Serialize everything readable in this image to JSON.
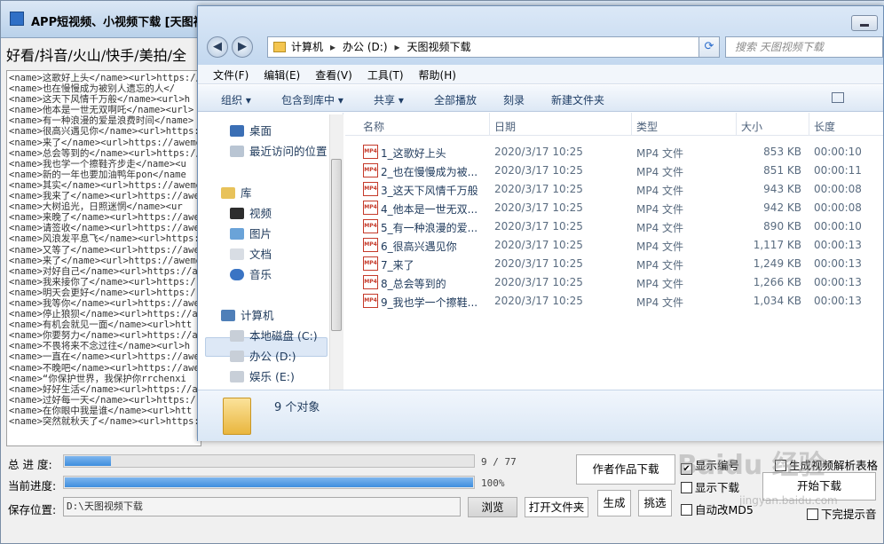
{
  "app": {
    "title": "APP短视频、小视频下载 [天图视频",
    "platforms": "好看/抖音/火山/快手/美拍/全",
    "log_lines": [
      "<name>这歌好上头</name><url>https://",
      "<name>也在慢慢成为被别人遗忘的人</",
      "<name>这天下风情千万般</name><url>h",
      "<name>他本是一世无双啊吒</name><url>",
      "<name>有一种浪漫的爱是浪费时间</name>",
      "<name>很高兴遇见你</name><url>https:",
      "<name>来了</name><url>https://aweme",
      "<name>总会等到的</name><url>https://",
      "<name>我也学一个擦鞋齐步走</name><u",
      "<name>新的一年也要加油鸭年pon</name",
      "<name>其实</name><url>https://aweme",
      "<name>我来了</name><url>https://awe",
      "<name>大树追光，日照迷惘</name><ur",
      "<name>来晚了</name><url>https://awe",
      "<name>请签收</name><url>https://awe",
      "<name>风浪发平息飞</name><url>https:",
      "<name>又等了</name><url>https://awe",
      "<name>来了</name><url>https://aweme",
      "<name>对好自己</name><url>https://a",
      "<name>我来接你了</name><url>https:/",
      "<name>明天会更好</name><url>https:/",
      "<name>我等你</name><url>https://awe",
      "<name>停止狼狈</name><url>https://a",
      "<name>有机会就见一面</name><url>htt",
      "<name>你要努力</name><url>https://a",
      "<name>不畏将来不念过往</name><url>h",
      "<name>一直在</name><url>https://awe",
      "<name>不晚吧</name><url>https://awe",
      "<name>“你保护世界，我保护你rrchenxi",
      "<name>好好生活</name><url>https://a",
      "<name>过好每一天</name><url>https:/",
      "<name>在你眼中我是谁</name><url>htt",
      "<name>突然就秋天了</name><url>https:"
    ],
    "total_progress_label": "总 进 度:",
    "total_progress_text": "9 / 77",
    "total_progress_value": 0.117,
    "current_progress_label": "当前进度:",
    "current_progress_text": "100%",
    "current_progress_value": 1.0,
    "save_label": "保存位置:",
    "save_path": "D:\\天图视频下载",
    "browse_label": "浏览",
    "open_folder_label": "打开文件夹",
    "author_download_label": "作者作品下载",
    "generate_label": "生成",
    "pick_label": "挑选",
    "show_number_label": "显示编号",
    "show_number_checked": true,
    "show_download_label": "显示下载",
    "auto_md5_label": "自动改MD5",
    "gen_table_label": "生成视频解析表格",
    "start_download_label": "开始下载",
    "finish_prompt_label": "下完提示音",
    "watermark": "Baidu 经验",
    "watermark_url": "jingyan.baidu.com"
  },
  "explorer": {
    "address": [
      "计算机",
      "办公 (D:)",
      "天图视频下载"
    ],
    "search_placeholder": "搜索 天图视频下载",
    "menu": [
      "文件(F)",
      "编辑(E)",
      "查看(V)",
      "工具(T)",
      "帮助(H)"
    ],
    "toolbar": [
      "组织 ▾",
      "包含到库中 ▾",
      "共享 ▾",
      "全部播放",
      "刻录",
      "新建文件夹"
    ],
    "nav": {
      "desktop": "桌面",
      "recent": "最近访问的位置",
      "library": "库",
      "videos": "视频",
      "pictures": "图片",
      "documents": "文档",
      "music": "音乐",
      "computer": "计算机",
      "drive_c": "本地磁盘 (C:)",
      "drive_d": "办公 (D:)",
      "drive_e": "娱乐 (E:)"
    },
    "columns": {
      "name": "名称",
      "date": "日期",
      "type": "类型",
      "size": "大小",
      "length": "长度"
    },
    "files": [
      {
        "name": "1_这歌好上头",
        "date": "2020/3/17 10:25",
        "type": "MP4 文件",
        "size": "853 KB",
        "length": "00:00:10"
      },
      {
        "name": "2_也在慢慢成为被...",
        "date": "2020/3/17 10:25",
        "type": "MP4 文件",
        "size": "851 KB",
        "length": "00:00:11"
      },
      {
        "name": "3_这天下风情千万般",
        "date": "2020/3/17 10:25",
        "type": "MP4 文件",
        "size": "943 KB",
        "length": "00:00:08"
      },
      {
        "name": "4_他本是一世无双...",
        "date": "2020/3/17 10:25",
        "type": "MP4 文件",
        "size": "942 KB",
        "length": "00:00:08"
      },
      {
        "name": "5_有一种浪漫的爱...",
        "date": "2020/3/17 10:25",
        "type": "MP4 文件",
        "size": "890 KB",
        "length": "00:00:10"
      },
      {
        "name": "6_很高兴遇见你",
        "date": "2020/3/17 10:25",
        "type": "MP4 文件",
        "size": "1,117 KB",
        "length": "00:00:13"
      },
      {
        "name": "7_来了",
        "date": "2020/3/17 10:25",
        "type": "MP4 文件",
        "size": "1,249 KB",
        "length": "00:00:13"
      },
      {
        "name": "8_总会等到的",
        "date": "2020/3/17 10:25",
        "type": "MP4 文件",
        "size": "1,266 KB",
        "length": "00:00:13"
      },
      {
        "name": "9_我也学一个擦鞋...",
        "date": "2020/3/17 10:25",
        "type": "MP4 文件",
        "size": "1,034 KB",
        "length": "00:00:13"
      }
    ],
    "status": "9 个对象"
  },
  "colors": {
    "accent": "#3e8ede",
    "explorer_chrome": "#c3d8ef",
    "mp4_icon": "#c53a2a"
  }
}
